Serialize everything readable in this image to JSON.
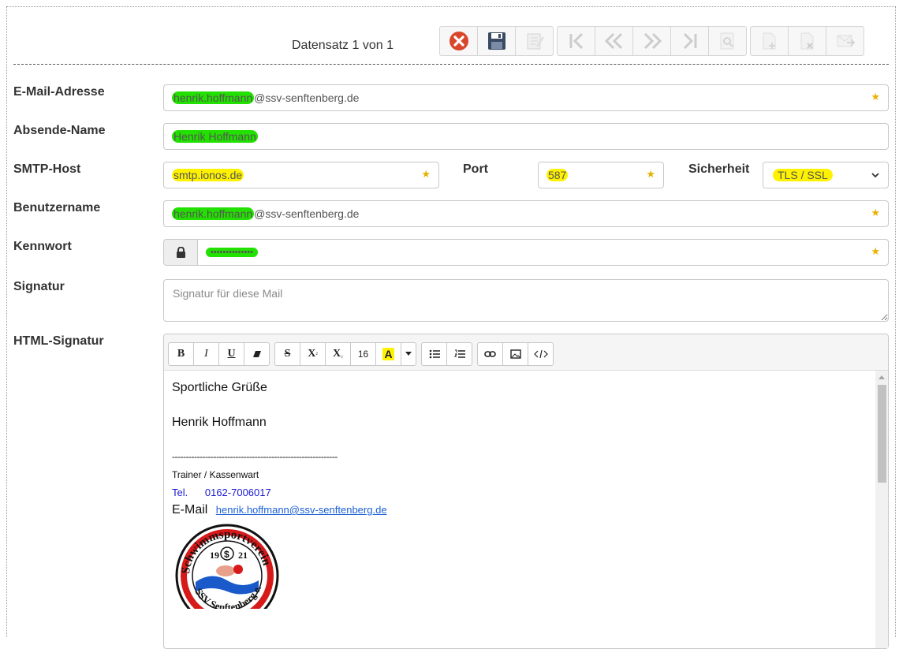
{
  "header": {
    "record_info": "Datensatz 1 von 1"
  },
  "toolbar": {
    "buttons": [
      {
        "name": "cancel",
        "icon": "close-circle-icon"
      },
      {
        "name": "save",
        "icon": "floppy-disk-icon"
      },
      {
        "name": "edit",
        "icon": "edit-note-icon"
      },
      {
        "name": "first",
        "icon": "first-record-icon"
      },
      {
        "name": "previous",
        "icon": "previous-record-icon"
      },
      {
        "name": "next",
        "icon": "next-record-icon"
      },
      {
        "name": "last",
        "icon": "last-record-icon"
      },
      {
        "name": "search",
        "icon": "search-doc-icon"
      },
      {
        "name": "new",
        "icon": "new-doc-icon"
      },
      {
        "name": "delete",
        "icon": "delete-doc-icon"
      },
      {
        "name": "send",
        "icon": "send-mail-icon"
      }
    ]
  },
  "form": {
    "email": {
      "label": "E-Mail-Adresse",
      "value_user": "henrik.hoffmann",
      "value_domain": "@ssv-senftenberg.de"
    },
    "sender_name": {
      "label": "Absende-Name",
      "value": "Henrik Hoffmann"
    },
    "smtp_host": {
      "label": "SMTP-Host",
      "value": "smtp.ionos.de"
    },
    "port": {
      "label": "Port",
      "value": "587"
    },
    "security": {
      "label": "Sicherheit",
      "value": "TLS / SSL"
    },
    "username": {
      "label": "Benutzername",
      "value_user": "henrik.hoffmann",
      "value_domain": "@ssv-senftenberg.de"
    },
    "password": {
      "label": "Kennwort",
      "value": "••••••••••••••"
    },
    "signature": {
      "label": "Signatur",
      "placeholder": "Signatur für diese Mail"
    },
    "html_signature": {
      "label": "HTML-Signatur"
    },
    "required_mark": "★"
  },
  "editor": {
    "toolbar": {
      "bold": "B",
      "italic": "I",
      "underline": "U",
      "strike": "S",
      "superscript": "X",
      "superscript_mark": "²",
      "subscript": "X",
      "subscript_mark": "₂",
      "font_size": "16",
      "highlight": "A"
    },
    "content": {
      "greeting": "Sportliche Grüße",
      "name": "Henrik Hoffmann",
      "divider": "------------------------------------------------------------",
      "role": "Trainer / Kassenwart",
      "tel_label": "Tel.",
      "tel_value": "0162-7006017",
      "email_label": "E-Mail",
      "email_value": "henrik.hoffmann@ssv-senftenberg.de",
      "logo": {
        "top_text": "Schwimmsportverein",
        "year_left": "19",
        "year_right": "21",
        "bottom_text": "SSV Senftenberg e.V.",
        "center_mark": "$"
      }
    }
  },
  "colors": {
    "required_star": "#e8b100",
    "highlight_green": "#22e000",
    "highlight_yellow": "#fff200",
    "link": "#1a5fd6",
    "cancel_red": "#d9472b"
  }
}
